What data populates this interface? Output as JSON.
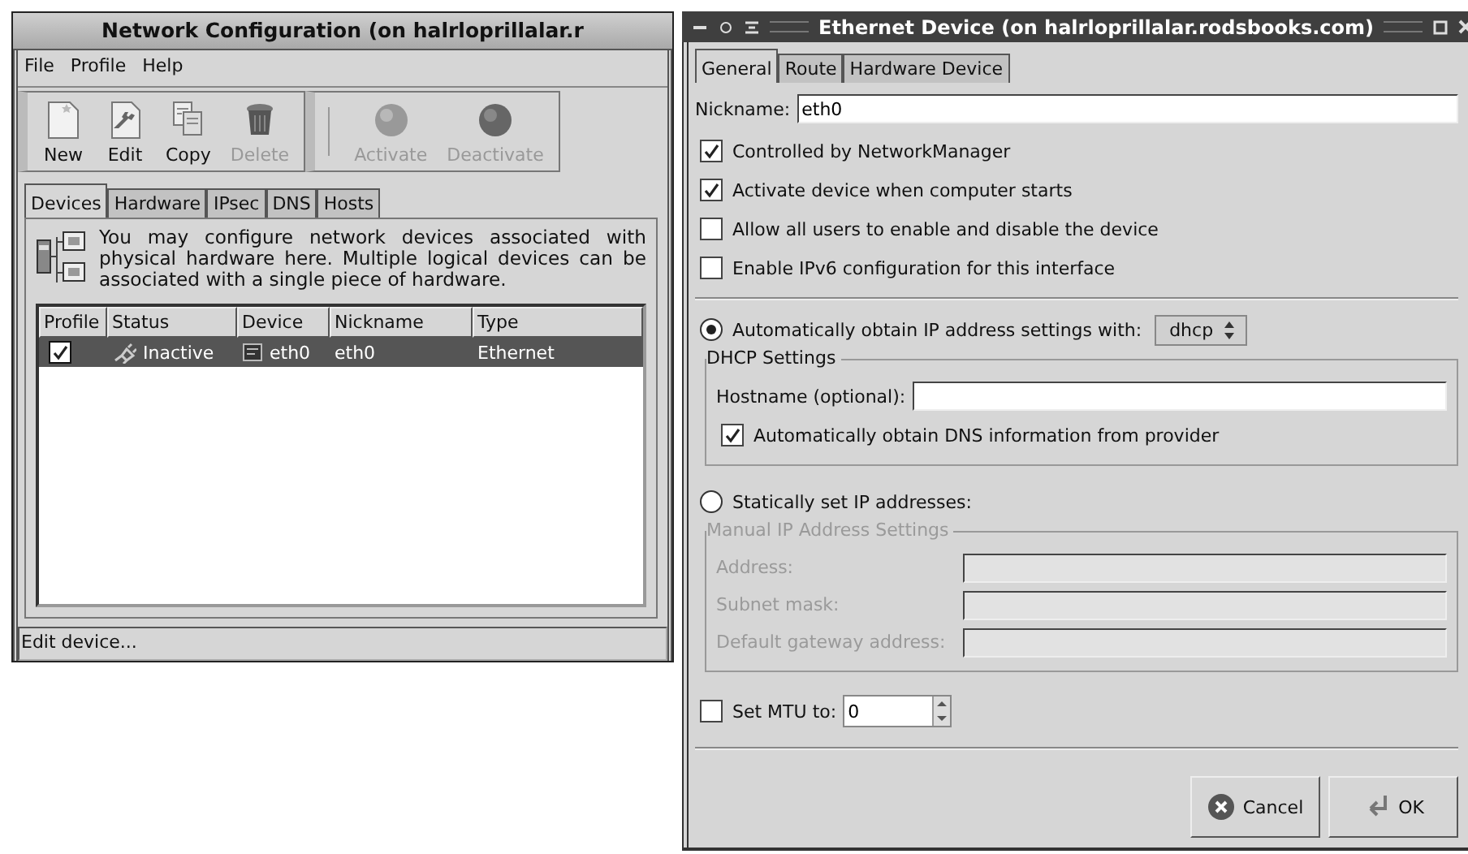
{
  "network_window": {
    "title": "Network Configuration (on halrloprillalar.r",
    "menu": [
      "File",
      "Profile",
      "Help"
    ],
    "toolbar": [
      {
        "label": "New",
        "kind": "new",
        "disabled": false
      },
      {
        "label": "Edit",
        "kind": "edit",
        "disabled": false
      },
      {
        "label": "Copy",
        "kind": "copy",
        "disabled": false
      },
      {
        "label": "Delete",
        "kind": "delete",
        "disabled": true
      }
    ],
    "toolbar_2": [
      {
        "label": "Activate",
        "kind": "activate",
        "disabled": true
      },
      {
        "label": "Deactivate",
        "kind": "deactivate",
        "disabled": true
      }
    ],
    "tabs": [
      {
        "label": "Devices",
        "selected": true
      },
      {
        "label": "Hardware",
        "selected": false
      },
      {
        "label": "IPsec",
        "selected": false
      },
      {
        "label": "DNS",
        "selected": false
      },
      {
        "label": "Hosts",
        "selected": false
      }
    ],
    "description": "You may configure network devices associated with physical hardware here.  Multiple logical devices can be associated with a single piece of hardware.",
    "table": {
      "columns": [
        "Profile",
        "Status",
        "Device",
        "Nickname",
        "Type"
      ],
      "rows": [
        {
          "selected": true,
          "profile_checked": true,
          "status": "Inactive",
          "device": "eth0",
          "nickname": "eth0",
          "type": "Ethernet"
        }
      ]
    },
    "status_bar": "Edit device..."
  },
  "ethernet_window": {
    "title": "Ethernet Device (on halrloprillalar.rodsbooks.com)",
    "tabs": [
      {
        "label": "General",
        "selected": true
      },
      {
        "label": "Route",
        "selected": false
      },
      {
        "label": "Hardware Device",
        "selected": false
      }
    ],
    "nickname": {
      "label": "Nickname:",
      "value": "eth0"
    },
    "options": [
      {
        "label": "Controlled by NetworkManager",
        "checked": true
      },
      {
        "label": "Activate device when computer starts",
        "checked": true
      },
      {
        "label": "Allow all users to enable and disable the device",
        "checked": false
      },
      {
        "label": "Enable IPv6 configuration for this interface",
        "checked": false
      }
    ],
    "auto_ip": {
      "label": "Automatically obtain IP address settings with:",
      "selected": true,
      "method": "dhcp"
    },
    "dhcp": {
      "title": "DHCP Settings",
      "hostname_label": "Hostname (optional):",
      "dns": {
        "label": "Automatically obtain DNS information from provider",
        "checked": true
      }
    },
    "static_ip": {
      "label": "Statically set IP addresses:",
      "selected": false
    },
    "manual": {
      "title": "Manual IP Address Settings",
      "disabled": true,
      "fields": [
        {
          "label": "Address:"
        },
        {
          "label": "Subnet mask:"
        },
        {
          "label": "Default gateway address:"
        }
      ]
    },
    "mtu": {
      "label": "Set MTU to:",
      "checked": false,
      "value": "0"
    },
    "buttons": [
      {
        "label": "Cancel",
        "kind": "cancel"
      },
      {
        "label": "OK",
        "kind": "ok"
      }
    ]
  }
}
